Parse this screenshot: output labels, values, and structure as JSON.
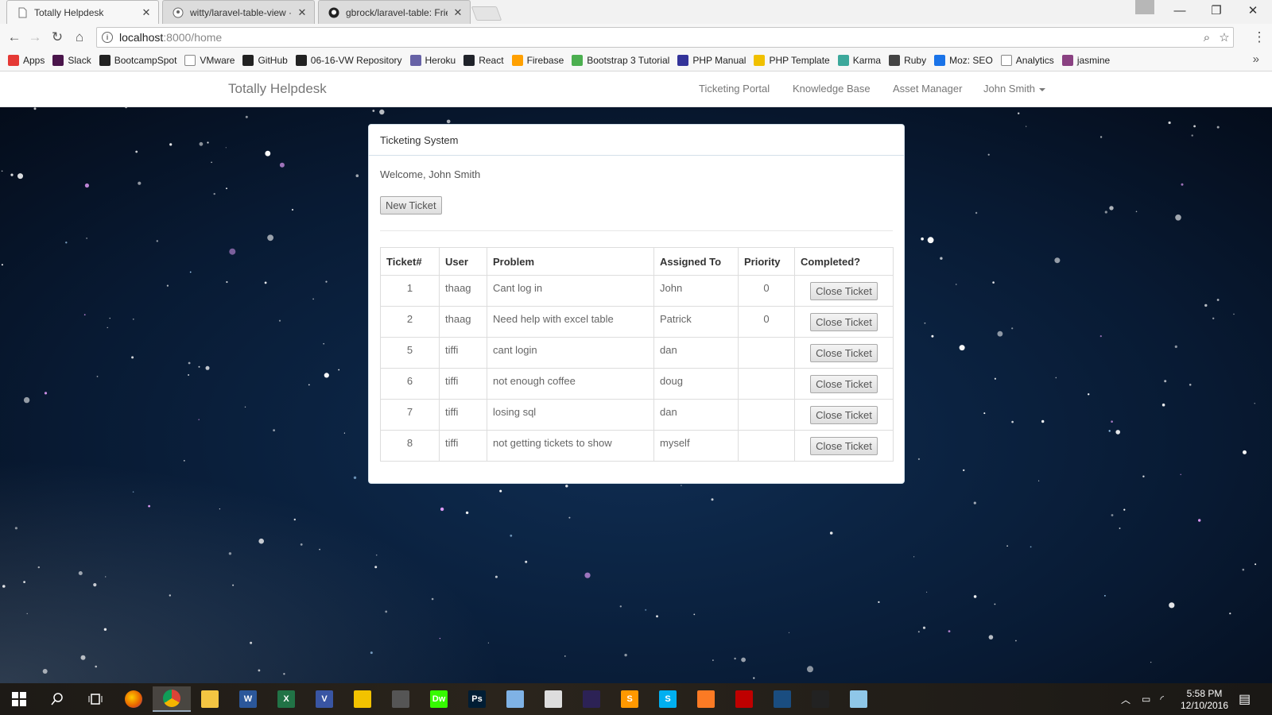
{
  "browser": {
    "tabs": [
      {
        "title": "Totally Helpdesk",
        "active": true
      },
      {
        "title": "witty/laravel-table-view ·",
        "active": false
      },
      {
        "title": "gbrock/laravel-table: Frie",
        "active": false
      }
    ],
    "url_host": "localhost",
    "url_path": ":8000/home",
    "bookmarks": [
      {
        "label": "Apps",
        "icon": "apps-grid-icon",
        "color": "#e53935"
      },
      {
        "label": "Slack",
        "icon": "slack-icon",
        "color": "#4a154b"
      },
      {
        "label": "BootcampSpot",
        "icon": "bootcampspot-icon",
        "color": "#222222"
      },
      {
        "label": "VMware",
        "icon": "page-icon",
        "color": "#ffffff"
      },
      {
        "label": "GitHub",
        "icon": "github-icon",
        "color": "#222222"
      },
      {
        "label": "06-16-VW Repository",
        "icon": "github-icon",
        "color": "#222222"
      },
      {
        "label": "Heroku",
        "icon": "heroku-icon",
        "color": "#6762a6"
      },
      {
        "label": "React",
        "icon": "react-icon",
        "color": "#20232a"
      },
      {
        "label": "Firebase",
        "icon": "firebase-icon",
        "color": "#ffa000"
      },
      {
        "label": "Bootstrap 3 Tutorial",
        "icon": "w3-icon",
        "color": "#4caf50"
      },
      {
        "label": "PHP Manual",
        "icon": "php-icon",
        "color": "#333399"
      },
      {
        "label": "PHP Template",
        "icon": "bulb-icon",
        "color": "#f0c000"
      },
      {
        "label": "Karma",
        "icon": "karma-icon",
        "color": "#3ca89b"
      },
      {
        "label": "Ruby",
        "icon": "ruby-icon",
        "color": "#444444"
      },
      {
        "label": "Moz: SEO",
        "icon": "moz-icon",
        "color": "#1a73e8"
      },
      {
        "label": "Analytics",
        "icon": "page-icon",
        "color": "#ffffff"
      },
      {
        "label": "jasmine",
        "icon": "jasmine-icon",
        "color": "#8a4182"
      }
    ]
  },
  "navbar": {
    "brand": "Totally Helpdesk",
    "links": [
      "Ticketing Portal",
      "Knowledge Base",
      "Asset Manager"
    ],
    "user": "John Smith"
  },
  "panel": {
    "heading": "Ticketing System",
    "welcome": "Welcome, John Smith",
    "new_ticket_label": "New Ticket",
    "columns": [
      "Ticket#",
      "User",
      "Problem",
      "Assigned To",
      "Priority",
      "Completed?"
    ],
    "action_label": "Close Ticket",
    "rows": [
      {
        "id": "1",
        "user": "thaag",
        "problem": "Cant log in",
        "assigned": "John",
        "priority": "0"
      },
      {
        "id": "2",
        "user": "thaag",
        "problem": "Need help with excel table",
        "assigned": "Patrick",
        "priority": "0"
      },
      {
        "id": "5",
        "user": "tiffi",
        "problem": "cant login",
        "assigned": "dan",
        "priority": ""
      },
      {
        "id": "6",
        "user": "tiffi",
        "problem": "not enough coffee",
        "assigned": "doug",
        "priority": ""
      },
      {
        "id": "7",
        "user": "tiffi",
        "problem": "losing sql",
        "assigned": "dan",
        "priority": ""
      },
      {
        "id": "8",
        "user": "tiffi",
        "problem": "not getting tickets to show",
        "assigned": "myself",
        "priority": ""
      }
    ]
  },
  "taskbar": {
    "time": "5:58 PM",
    "date": "12/10/2016",
    "apps": [
      {
        "name": "start-icon",
        "label": "",
        "color": "#ffffff"
      },
      {
        "name": "search-icon",
        "label": "",
        "color": "#ffffff"
      },
      {
        "name": "task-view-icon",
        "label": "",
        "color": "#ffffff"
      },
      {
        "name": "firefox-icon",
        "label": "",
        "color": "#e66000"
      },
      {
        "name": "chrome-icon",
        "label": "",
        "color": "#4caf50"
      },
      {
        "name": "file-explorer-icon",
        "label": "",
        "color": "#f4c542"
      },
      {
        "name": "word-icon",
        "label": "W",
        "color": "#2b579a"
      },
      {
        "name": "excel-icon",
        "label": "X",
        "color": "#217346"
      },
      {
        "name": "visio-icon",
        "label": "V",
        "color": "#3955a3"
      },
      {
        "name": "sticky-app-icon",
        "label": "",
        "color": "#f2c200"
      },
      {
        "name": "calculator-icon",
        "label": "",
        "color": "#555555"
      },
      {
        "name": "dreamweaver-icon",
        "label": "Dw",
        "color": "#35fa00"
      },
      {
        "name": "photoshop-icon",
        "label": "Ps",
        "color": "#001d34"
      },
      {
        "name": "paint-icon",
        "label": "",
        "color": "#7fb2e5"
      },
      {
        "name": "inkscape-icon",
        "label": "",
        "color": "#dddddd"
      },
      {
        "name": "eclipse-icon",
        "label": "",
        "color": "#2c2255"
      },
      {
        "name": "sublime-icon",
        "label": "S",
        "color": "#ff9800"
      },
      {
        "name": "skype-icon",
        "label": "S",
        "color": "#00aff0"
      },
      {
        "name": "xampp-icon",
        "label": "",
        "color": "#fb7a24"
      },
      {
        "name": "filezilla-icon",
        "label": "",
        "color": "#bf0000"
      },
      {
        "name": "mysql-icon",
        "label": "",
        "color": "#1a4d80"
      },
      {
        "name": "terminal-icon",
        "label": "",
        "color": "#222222"
      },
      {
        "name": "notes-icon",
        "label": "",
        "color": "#8fc7e8"
      }
    ]
  }
}
